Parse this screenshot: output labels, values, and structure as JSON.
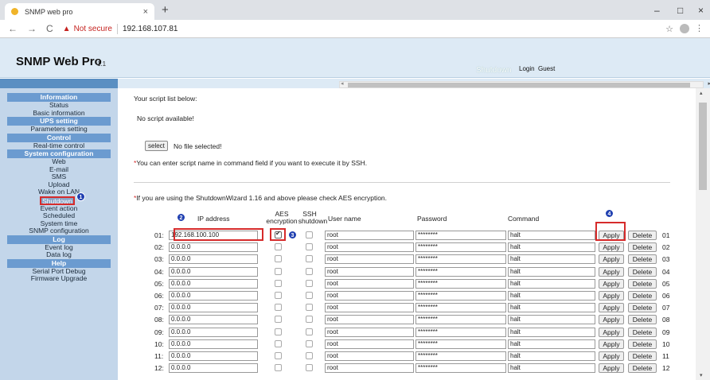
{
  "browser": {
    "tab_title": "SNMP web pro",
    "tab_close": "×",
    "new_tab": "+",
    "not_secure": "Not secure",
    "url": "192.168.107.81",
    "back": "←",
    "forward": "→",
    "reload": "C",
    "warning_glyph": "▲",
    "star_glyph": "☆",
    "menu_glyph": "⋮",
    "win_minimize": "–",
    "win_maximize": "□",
    "win_close": "×"
  },
  "header": {
    "app_title": "SNMP Web Pro",
    "app_version": "1.1",
    "shutdown": "Shutdown",
    "login": "Login",
    "guest": "Guest"
  },
  "sidebar": {
    "sections": [
      {
        "title": "Information",
        "items": [
          "Status",
          "Basic information"
        ]
      },
      {
        "title": "UPS setting",
        "items": [
          "Parameters setting"
        ]
      },
      {
        "title": "Control",
        "items": [
          "Real-time control"
        ]
      },
      {
        "title": "System configuration",
        "items": [
          "Web",
          "E-mail",
          "SMS",
          "Upload",
          "Wake on LAN",
          "Shutdown",
          "Event action",
          "Scheduled",
          "System time",
          "SNMP configuration"
        ]
      },
      {
        "title": "Log",
        "items": [
          "Event log",
          "Data log"
        ]
      },
      {
        "title": "Help",
        "items": [
          "Serial Port Debug",
          "Firmware Upgrade"
        ]
      }
    ],
    "active_item": "Shutdown"
  },
  "main": {
    "script_list_label": "Your script list below:",
    "no_script": "No script available!",
    "select_button": "select",
    "no_file": "No file selected!",
    "ssh_note_star": "*",
    "ssh_note": "You can enter script name in command field if you want to execute it by SSH.",
    "aes_note_star": "*",
    "aes_note": "If you are using the ShutdownWizard 1.16 and above please check AES encryption.",
    "table": {
      "headers": {
        "ip": "IP address",
        "aes_line1": "AES",
        "aes_line2": "encryption",
        "ssh_line1": "SSH",
        "ssh_line2": "shutdown",
        "user": "User name",
        "password": "Password",
        "command": "Command"
      },
      "apply_label": "Apply",
      "delete_label": "Delete",
      "rows": [
        {
          "no": "01:",
          "ip": "192.168.100.100",
          "aes": true,
          "ssh": false,
          "user": "root",
          "password": "********",
          "command": "halt",
          "id": "01"
        },
        {
          "no": "02:",
          "ip": "0.0.0.0",
          "aes": false,
          "ssh": false,
          "user": "root",
          "password": "********",
          "command": "halt",
          "id": "02"
        },
        {
          "no": "03:",
          "ip": "0.0.0.0",
          "aes": false,
          "ssh": false,
          "user": "root",
          "password": "********",
          "command": "halt",
          "id": "03"
        },
        {
          "no": "04:",
          "ip": "0.0.0.0",
          "aes": false,
          "ssh": false,
          "user": "root",
          "password": "********",
          "command": "halt",
          "id": "04"
        },
        {
          "no": "05:",
          "ip": "0.0.0.0",
          "aes": false,
          "ssh": false,
          "user": "root",
          "password": "********",
          "command": "halt",
          "id": "05"
        },
        {
          "no": "06:",
          "ip": "0.0.0.0",
          "aes": false,
          "ssh": false,
          "user": "root",
          "password": "********",
          "command": "halt",
          "id": "06"
        },
        {
          "no": "07:",
          "ip": "0.0.0.0",
          "aes": false,
          "ssh": false,
          "user": "root",
          "password": "********",
          "command": "halt",
          "id": "07"
        },
        {
          "no": "08:",
          "ip": "0.0.0.0",
          "aes": false,
          "ssh": false,
          "user": "root",
          "password": "********",
          "command": "halt",
          "id": "08"
        },
        {
          "no": "09:",
          "ip": "0.0.0.0",
          "aes": false,
          "ssh": false,
          "user": "root",
          "password": "********",
          "command": "halt",
          "id": "09"
        },
        {
          "no": "10:",
          "ip": "0.0.0.0",
          "aes": false,
          "ssh": false,
          "user": "root",
          "password": "********",
          "command": "halt",
          "id": "10"
        },
        {
          "no": "11:",
          "ip": "0.0.0.0",
          "aes": false,
          "ssh": false,
          "user": "root",
          "password": "********",
          "command": "halt",
          "id": "11"
        },
        {
          "no": "12:",
          "ip": "0.0.0.0",
          "aes": false,
          "ssh": false,
          "user": "root",
          "password": "********",
          "command": "halt",
          "id": "12"
        }
      ]
    }
  },
  "annotations": {
    "b1": "1",
    "b2": "2",
    "b3": "3",
    "b4": "4"
  },
  "colors": {
    "highlight": "#d62b2b",
    "sidebar_section": "#6b9bd0",
    "badge": "#1f3fb0"
  }
}
